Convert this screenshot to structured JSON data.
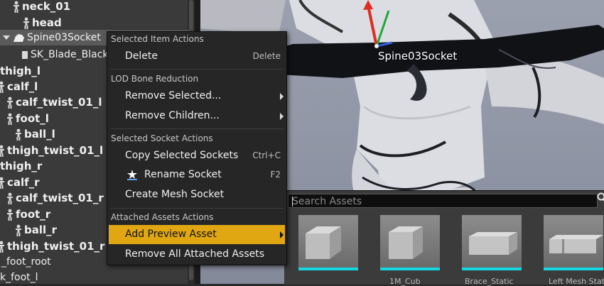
{
  "skeleton_tree": {
    "rows": [
      {
        "label": "neck_01"
      },
      {
        "label": "head"
      },
      {
        "label": "Spine03Socket"
      },
      {
        "label": "SK_Blade_Black"
      },
      {
        "label": "thigh_l"
      },
      {
        "label": "calf_l"
      },
      {
        "label": "calf_twist_01_l"
      },
      {
        "label": "foot_l"
      },
      {
        "label": "ball_l"
      },
      {
        "label": "thigh_twist_01_l"
      },
      {
        "label": "thigh_r"
      },
      {
        "label": "calf_r"
      },
      {
        "label": "calf_twist_01_r"
      },
      {
        "label": "foot_r"
      },
      {
        "label": "ball_r"
      },
      {
        "label": "thigh_twist_01_r"
      },
      {
        "label": "_foot_root"
      },
      {
        "label": "k_foot_l"
      }
    ]
  },
  "viewport": {
    "socket_label": "Spine03Socket"
  },
  "context_menu": {
    "sections": [
      {
        "header": "Selected Item Actions",
        "items": [
          {
            "label": "Delete",
            "shortcut": "Delete"
          }
        ]
      },
      {
        "header": "LOD Bone Reduction",
        "items": [
          {
            "label": "Remove Selected..."
          },
          {
            "label": "Remove Children..."
          }
        ]
      },
      {
        "header": "Selected Socket Actions",
        "items": [
          {
            "label": "Copy Selected Sockets",
            "shortcut": "Ctrl+C"
          },
          {
            "label": "Rename Socket",
            "shortcut": "F2"
          },
          {
            "label": "Create Mesh Socket"
          }
        ]
      },
      {
        "header": "Attached Assets Actions",
        "items": [
          {
            "label": "Add Preview Asset"
          },
          {
            "label": "Remove All Attached Assets"
          }
        ]
      }
    ]
  },
  "asset_picker": {
    "search_placeholder": "Search Assets",
    "tiles": [
      {
        "label": ""
      },
      {
        "label": "1M_Cub"
      },
      {
        "label": "Brace_Static"
      },
      {
        "label": "Left Mesh Stati"
      }
    ]
  },
  "colors": {
    "menu_highlight": "#e0a712",
    "asset_underline": "#13d8e0"
  }
}
